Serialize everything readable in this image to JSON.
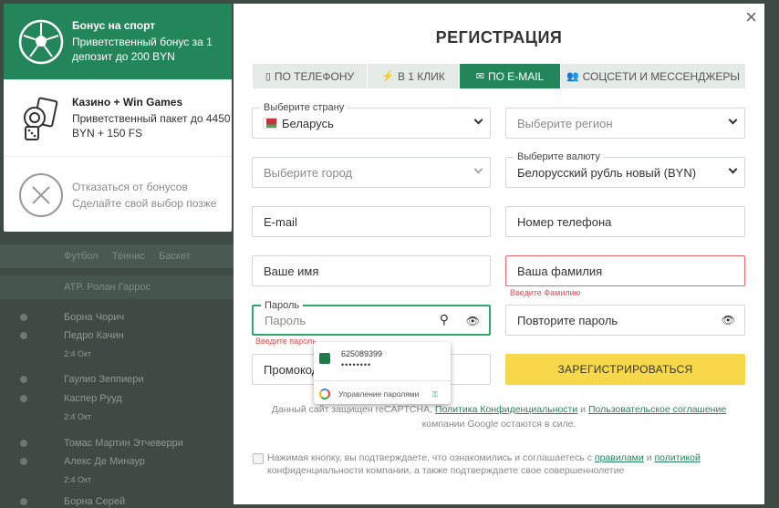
{
  "bonus_panel": {
    "items": [
      {
        "title": "Бонус на спорт",
        "text": "Приветственный бонус за 1 депозит до 200 BYN",
        "icon": "soccer-ball-icon"
      },
      {
        "title": "Казино + Win Games",
        "text": "Приветственный пакет до 4450 BYN + 150 FS",
        "icon": "casino-cards-dice-icon"
      },
      {
        "title": "Отказаться от бонусов",
        "text": "Сделайте свой выбор позже",
        "icon": "decline-x-icon"
      }
    ]
  },
  "background": {
    "rows": [
      "Футбол",
      "Теннис",
      "Баскет",
      "ATP. Ролан Гаррос",
      "Борна Чорич",
      "Педро Качин",
      "2:4 Окт",
      "Гаулио Зеппиери",
      "Каспер Рууд",
      "2:4 Окт",
      "Томас Мартин Этчеверри",
      "Алекс Де Минаур",
      "2:4 Окт",
      "Борна Серей"
    ]
  },
  "modal": {
    "title": "РЕГИСТРАЦИЯ",
    "close": "×",
    "tabs": [
      {
        "label": "ПО ТЕЛЕФОНУ",
        "icon": "▯",
        "active": false
      },
      {
        "label": "В 1 КЛИК",
        "icon": "⚡",
        "active": false
      },
      {
        "label": "ПО E-MAIL",
        "icon": "✉",
        "active": true
      },
      {
        "label": "СОЦСЕТИ И МЕССЕНДЖЕРЫ",
        "icon": "👥",
        "active": false
      }
    ],
    "country": {
      "label": "Выберите страну",
      "value": "Беларусь"
    },
    "region": {
      "placeholder": "Выберите регион"
    },
    "city": {
      "placeholder": "Выберите город"
    },
    "currency": {
      "label": "Выберите валюту",
      "value": "Белорусский рубль новый (BYN)"
    },
    "email": {
      "placeholder": "E-mail"
    },
    "phone": {
      "placeholder": "Номер телефона"
    },
    "first_name": {
      "placeholder": "Ваше имя"
    },
    "last_name": {
      "placeholder": "Ваша фамилия",
      "error": "Введите Фамилию"
    },
    "password": {
      "label": "Пароль",
      "placeholder": "Пароль",
      "error": "Введите пароль"
    },
    "password_repeat": {
      "placeholder": "Повторите пароль"
    },
    "promo": {
      "placeholder": "Промокод"
    },
    "submit": "ЗАРЕГИСТРИРОВАТЬСЯ",
    "recaptcha_prefix": "Данный сайт защищен reCAPTCHA,",
    "privacy_link": "Политика Конфиденциальности",
    "and": "и",
    "terms_link": "Пользовательское соглашение",
    "recaptcha_suffix": "компании Google остаются в силе.",
    "agree_prefix": "Нажимая кнопку, вы подтверждаете, что ознакомились и соглашаетесь с",
    "rules_link": "правилами",
    "agree_and": "и",
    "policy_link": "политикой",
    "agree_suffix": "конфиденциальности компании, а также подтверждаете свое совершеннолетие"
  },
  "autofill": {
    "account": "625089399",
    "password_mask": "••••••••",
    "manage": "Управление паролями"
  },
  "colors": {
    "accent": "#23855a",
    "button": "#f7d84a",
    "error": "#e24b4b"
  }
}
